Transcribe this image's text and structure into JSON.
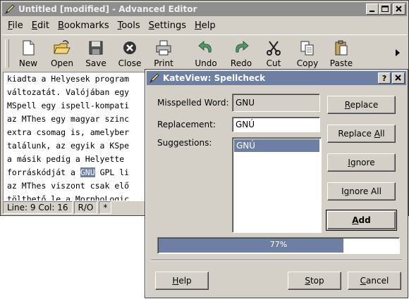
{
  "main_window": {
    "title": "Untitled [modified] - Advanced Editor",
    "menu": [
      "File",
      "Edit",
      "Bookmarks",
      "Tools",
      "Settings",
      "Help"
    ],
    "toolbar": [
      {
        "label": "New",
        "icon": "new-file-icon"
      },
      {
        "label": "Open",
        "icon": "open-folder-icon"
      },
      {
        "label": "Save",
        "icon": "save-disk-icon"
      },
      {
        "label": "Close",
        "icon": "close-circle-icon"
      },
      {
        "label": "Print",
        "icon": "printer-icon"
      },
      {
        "label": "Undo",
        "icon": "undo-icon"
      },
      {
        "label": "Redo",
        "icon": "redo-icon"
      },
      {
        "label": "Cut",
        "icon": "scissors-icon"
      },
      {
        "label": "Copy",
        "icon": "copy-icon"
      },
      {
        "label": "Paste",
        "icon": "paste-icon"
      }
    ],
    "editor_lines": [
      {
        "text": "kiadta a Helyesek program"
      },
      {
        "text": "változatát. Valójában egy"
      },
      {
        "text": "MSpell egy ispell-kompati"
      },
      {
        "text": "az MThes egy magyar szinc"
      },
      {
        "text": "extra csomag is, amelyber"
      },
      {
        "text": "találunk, az egyik a KSpe"
      },
      {
        "text": "a másik pedig a Helyette"
      },
      {
        "before": "forráskódját a ",
        "highlight": "GNU",
        "after": " GPL li"
      },
      {
        "text": "az MThes viszont csak elő"
      },
      {
        "text": "tölthető le a MorphoLogic"
      }
    ],
    "status": [
      "Line: 9 Col: 16",
      "R/O",
      "*"
    ]
  },
  "dialog": {
    "title": "KateView: Spellcheck",
    "misspelled_label": "Misspelled Word:",
    "misspelled_value": "GNU",
    "replacement_label": "Replacement:",
    "replacement_value": "GNÚ",
    "suggestions_label": "Suggestions:",
    "suggestions": [
      "GNÚ"
    ],
    "buttons": {
      "replace": {
        "pre": "",
        "u": "R",
        "post": "eplace"
      },
      "replace_all": {
        "pre": "Replace ",
        "u": "A",
        "post": "ll"
      },
      "ignore": {
        "pre": "",
        "u": "I",
        "post": "gnore"
      },
      "ignore_all": {
        "pre": "I",
        "u": "g",
        "post": "nore All"
      },
      "add": {
        "pre": "",
        "u": "A",
        "post": "dd"
      },
      "help": {
        "pre": "",
        "u": "H",
        "post": "elp"
      },
      "stop": {
        "pre": "",
        "u": "S",
        "post": "top"
      },
      "cancel": {
        "pre": "",
        "u": "C",
        "post": "ancel"
      }
    },
    "progress": {
      "value": 0.77,
      "text": "77%"
    }
  },
  "colors": {
    "accent": "#6e7fa4",
    "face": "#d4d0c8",
    "inactive_title": "#8f8f8f"
  }
}
